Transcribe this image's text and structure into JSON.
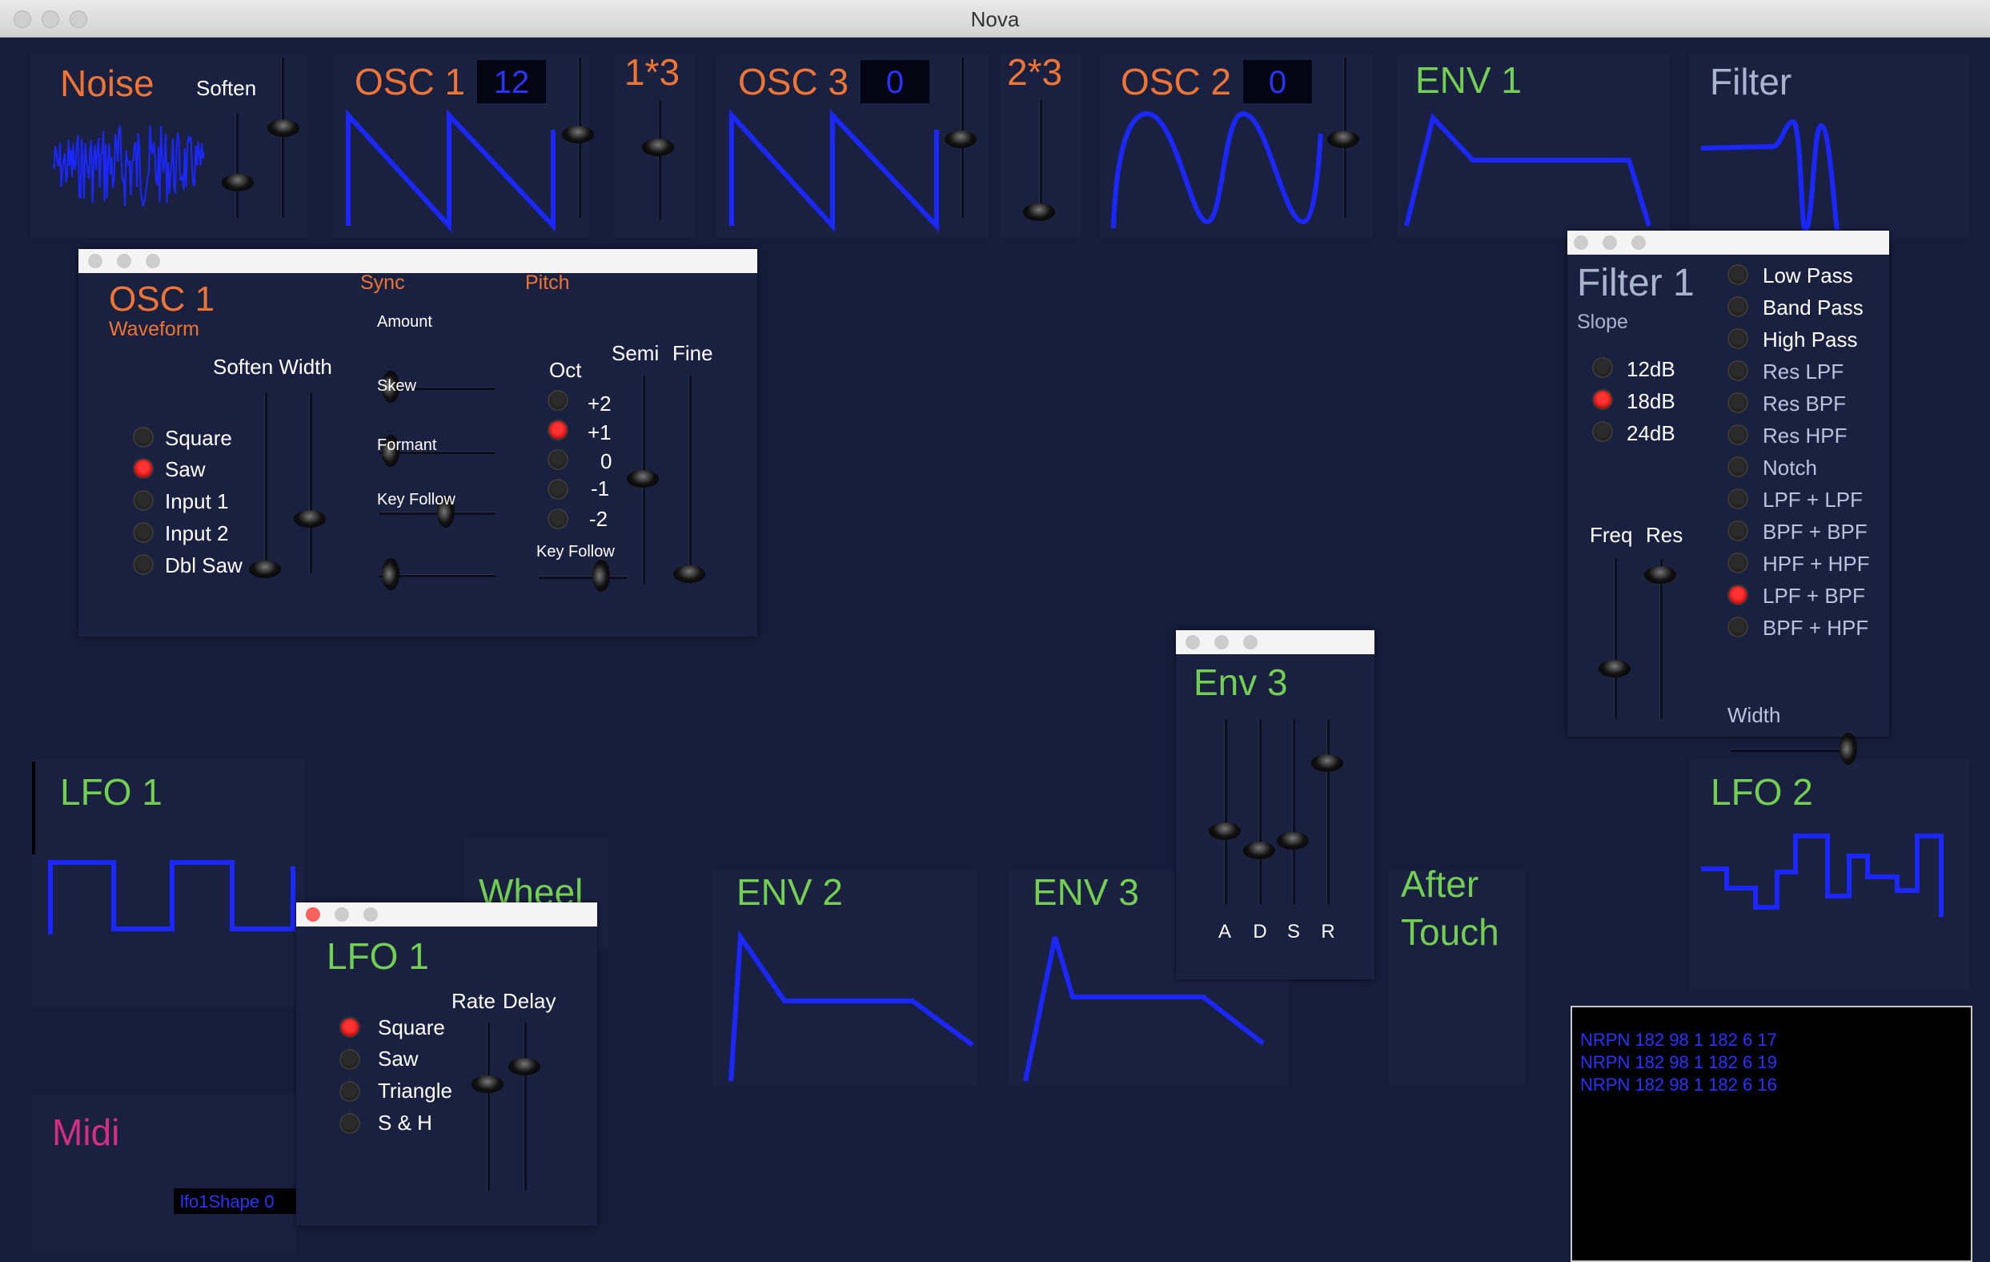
{
  "window": {
    "title": "Nova"
  },
  "top_row": {
    "noise": {
      "label": "Noise",
      "soften_label": "Soften"
    },
    "osc1": {
      "label": "OSC 1",
      "value": "12"
    },
    "mod13": {
      "label": "1*3"
    },
    "osc3": {
      "label": "OSC 3",
      "value": "0"
    },
    "mod23": {
      "label": "2*3"
    },
    "osc2": {
      "label": "OSC 2",
      "value": "0"
    },
    "env1": {
      "label": "ENV 1"
    },
    "filter": {
      "label": "Filter"
    }
  },
  "osc1_panel": {
    "title": "OSC 1",
    "waveform_label": "Waveform",
    "sync_label": "Sync",
    "pitch_label": "Pitch",
    "soften_width_label": "Soften Width",
    "waveforms": [
      {
        "label": "Square",
        "selected": false
      },
      {
        "label": "Saw",
        "selected": true
      },
      {
        "label": "Input 1",
        "selected": false
      },
      {
        "label": "Input 2",
        "selected": false
      },
      {
        "label": "Dbl Saw",
        "selected": false
      }
    ],
    "sync_sliders": [
      {
        "label": "Amount"
      },
      {
        "label": "Skew"
      },
      {
        "label": "Formant"
      },
      {
        "label": "Key Follow"
      }
    ],
    "oct_label": "Oct",
    "semi_label": "Semi",
    "fine_label": "Fine",
    "octaves": [
      {
        "label": "+2",
        "selected": false
      },
      {
        "label": "+1",
        "selected": true
      },
      {
        "label": "0",
        "selected": false
      },
      {
        "label": "-1",
        "selected": false
      },
      {
        "label": "-2",
        "selected": false
      }
    ],
    "pitch_key_follow_label": "Key Follow"
  },
  "filter_panel": {
    "title": "Filter 1",
    "slope_label": "Slope",
    "slopes": [
      {
        "label": "12dB",
        "selected": false
      },
      {
        "label": "18dB",
        "selected": true
      },
      {
        "label": "24dB",
        "selected": false
      }
    ],
    "freq_label": "Freq",
    "res_label": "Res",
    "width_label": "Width",
    "types": [
      {
        "label": "Low Pass",
        "selected": false,
        "bright": true
      },
      {
        "label": "Band Pass",
        "selected": false,
        "bright": true
      },
      {
        "label": "High Pass",
        "selected": false,
        "bright": true
      },
      {
        "label": "Res LPF",
        "selected": false,
        "bright": false
      },
      {
        "label": "Res BPF",
        "selected": false,
        "bright": false
      },
      {
        "label": "Res HPF",
        "selected": false,
        "bright": false
      },
      {
        "label": "Notch",
        "selected": false,
        "bright": false
      },
      {
        "label": "LPF + LPF",
        "selected": false,
        "bright": false
      },
      {
        "label": "BPF + BPF",
        "selected": false,
        "bright": false
      },
      {
        "label": "HPF + HPF",
        "selected": false,
        "bright": false
      },
      {
        "label": "LPF + BPF",
        "selected": true,
        "bright": false
      },
      {
        "label": "BPF + HPF",
        "selected": false,
        "bright": false
      }
    ]
  },
  "env3_panel": {
    "title": "Env 3",
    "adsr": [
      "A",
      "D",
      "S",
      "R"
    ]
  },
  "bottom_row": {
    "lfo1": {
      "label": "LFO 1"
    },
    "wheel": {
      "label": "Wheel"
    },
    "env2": {
      "label": "ENV 2"
    },
    "env3": {
      "label": "ENV 3"
    },
    "aftertouch": {
      "line1": "After",
      "line2": "Touch"
    },
    "lfo2": {
      "label": "LFO 2"
    },
    "midi": {
      "label": "Midi"
    },
    "status": "lfo1Shape 0"
  },
  "lfo1_panel": {
    "title": "LFO 1",
    "rate_label": "Rate",
    "delay_label": "Delay",
    "shapes": [
      {
        "label": "Square",
        "selected": true
      },
      {
        "label": "Saw",
        "selected": false
      },
      {
        "label": "Triangle",
        "selected": false
      },
      {
        "label": "S & H",
        "selected": false
      }
    ]
  },
  "console": {
    "lines": [
      "NRPN 182 98 1 182 6 17",
      "NRPN 182 98 1 182 6 19",
      "NRPN 182 98 1 182 6 16"
    ]
  },
  "colors": {
    "background": "#161d3a",
    "orange": "#ee7535",
    "green": "#72cf52",
    "wave": "#1a28ff",
    "selected_radio": "#ff2222",
    "midi": "#d32f7f"
  }
}
